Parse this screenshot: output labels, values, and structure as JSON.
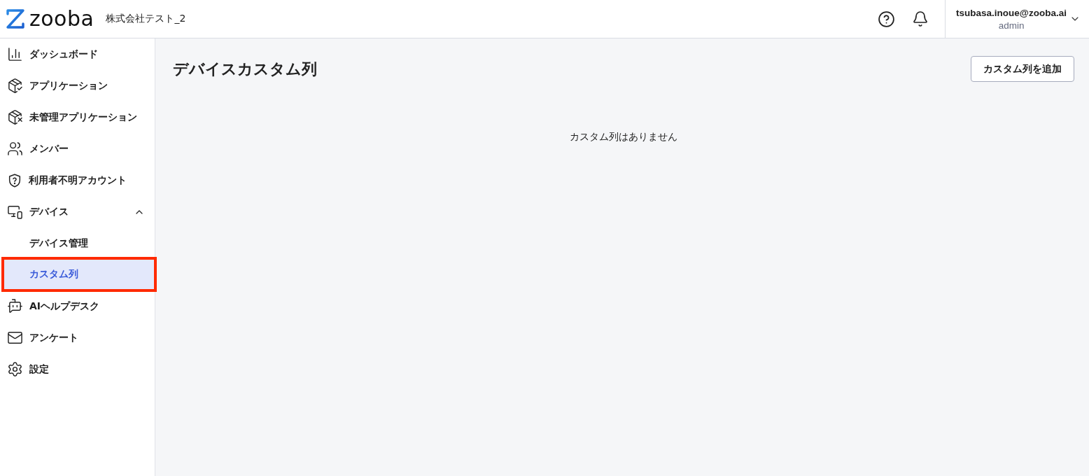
{
  "header": {
    "logo": "zooba",
    "company": "株式会社テスト_2",
    "user": {
      "email": "tsubasa.inoue@zooba.ai",
      "role": "admin"
    }
  },
  "sidebar": {
    "items": [
      {
        "label": "ダッシュボード",
        "selected": false
      },
      {
        "label": "アプリケーション",
        "selected": false
      },
      {
        "label": "未管理アプリケーション",
        "selected": false
      },
      {
        "label": "メンバー",
        "selected": false
      },
      {
        "label": "利用者不明アカウント",
        "selected": false
      },
      {
        "label": "デバイス",
        "selected": false,
        "expanded": true,
        "children": [
          {
            "label": "デバイス管理",
            "selected": false,
            "highlighted": false
          },
          {
            "label": "カスタム列",
            "selected": true,
            "highlighted": true
          }
        ]
      },
      {
        "label": "AIヘルプデスク",
        "selected": false
      },
      {
        "label": "アンケート",
        "selected": false
      },
      {
        "label": "設定",
        "selected": false
      }
    ]
  },
  "page": {
    "title": "デバイスカスタム列",
    "add_button": "カスタム列を追加",
    "empty_message": "カスタム列はありません"
  }
}
